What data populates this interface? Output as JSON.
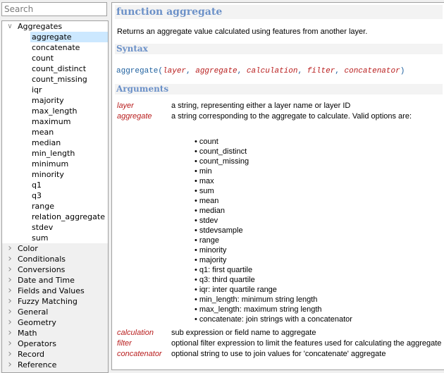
{
  "search": {
    "placeholder": "Search",
    "value": ""
  },
  "tree": {
    "expanded_group": "Aggregates",
    "selected_item": "aggregate",
    "aggregates_items": [
      "aggregate",
      "concatenate",
      "count",
      "count_distinct",
      "count_missing",
      "iqr",
      "majority",
      "max_length",
      "maximum",
      "mean",
      "median",
      "min_length",
      "minimum",
      "minority",
      "q1",
      "q3",
      "range",
      "relation_aggregate",
      "stdev",
      "sum"
    ],
    "collapsed_groups": [
      "Color",
      "Conditionals",
      "Conversions",
      "Date and Time",
      "Fields and Values",
      "Fuzzy Matching",
      "General",
      "Geometry",
      "Math",
      "Operators",
      "Record",
      "Reference"
    ]
  },
  "help": {
    "title": "function aggregate",
    "description": "Returns an aggregate value calculated using features from another layer.",
    "syntax_heading": "Syntax",
    "syntax": {
      "function": "aggregate",
      "args": [
        "layer",
        "aggregate",
        "calculation",
        "filter",
        "concatenator"
      ]
    },
    "arguments_heading": "Arguments",
    "arguments": [
      {
        "name": "layer",
        "description": "a string, representing either a layer name or layer ID"
      },
      {
        "name": "aggregate",
        "description": "a string corresponding to the aggregate to calculate. Valid options are:"
      },
      {
        "name": "calculation",
        "description": "sub expression or field name to aggregate"
      },
      {
        "name": "filter",
        "description": "optional filter expression to limit the features used for calculating the aggregate"
      },
      {
        "name": "concatenator",
        "description": "optional string to use to join values for 'concatenate' aggregate"
      }
    ],
    "aggregate_options": [
      "count",
      "count_distinct",
      "count_missing",
      "min",
      "max",
      "sum",
      "mean",
      "median",
      "stdev",
      "stdevsample",
      "range",
      "minority",
      "majority",
      "q1: first quartile",
      "q3: third quartile",
      "iqr: inter quartile range",
      "min_length: minimum string length",
      "max_length: maximum string length",
      "concatenate: join strings with a concatenator"
    ]
  }
}
